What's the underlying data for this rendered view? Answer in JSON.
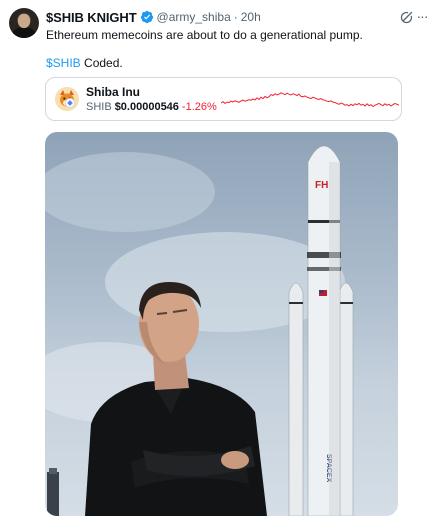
{
  "author": {
    "name": "$SHIB KNIGHT",
    "handle": "@army_shiba",
    "separator": "·",
    "time": "20h"
  },
  "tweet": {
    "text_line1": "Ethereum memecoins are about to do a generational pump.",
    "cashtag": "$SHIB",
    "text_line2_rest": " Coded."
  },
  "ticker_card": {
    "name": "Shiba Inu",
    "symbol": "SHIB",
    "price": "$0.00000546",
    "change": "-1.26%",
    "sparkline": [
      0.32,
      0.38,
      0.3,
      0.36,
      0.34,
      0.4,
      0.37,
      0.42,
      0.38,
      0.35,
      0.41,
      0.45,
      0.4,
      0.43,
      0.47,
      0.44,
      0.5,
      0.46,
      0.55,
      0.48,
      0.58,
      0.52,
      0.62,
      0.56,
      0.6,
      0.7,
      0.66,
      0.74,
      0.68,
      0.72,
      0.78,
      0.74,
      0.7,
      0.76,
      0.72,
      0.68,
      0.74,
      0.7,
      0.66,
      0.72,
      0.62,
      0.6,
      0.64,
      0.58,
      0.55,
      0.52,
      0.58,
      0.54,
      0.5,
      0.48,
      0.52,
      0.46,
      0.44,
      0.4,
      0.38,
      0.42,
      0.36,
      0.34,
      0.3,
      0.26,
      0.32,
      0.28,
      0.22,
      0.24,
      0.18,
      0.26,
      0.2,
      0.28,
      0.24,
      0.3,
      0.22,
      0.26,
      0.18,
      0.28,
      0.2,
      0.24,
      0.16,
      0.22,
      0.26,
      0.3,
      0.24,
      0.2,
      0.28,
      0.22,
      0.26,
      0.18,
      0.24,
      0.3,
      0.26,
      0.22
    ]
  },
  "photo": {
    "rocket_badge": "FH",
    "rocket_text": "SPACEX"
  },
  "colors": {
    "accent": "#1d9bf0",
    "negative": "#f4212e",
    "secondary_text": "#536471",
    "verified": "#1d9bf0"
  },
  "icons": [
    "verified-badge-icon",
    "grok-icon",
    "more-icon",
    "shiba-coin-icon",
    "ethereum-badge-icon"
  ]
}
